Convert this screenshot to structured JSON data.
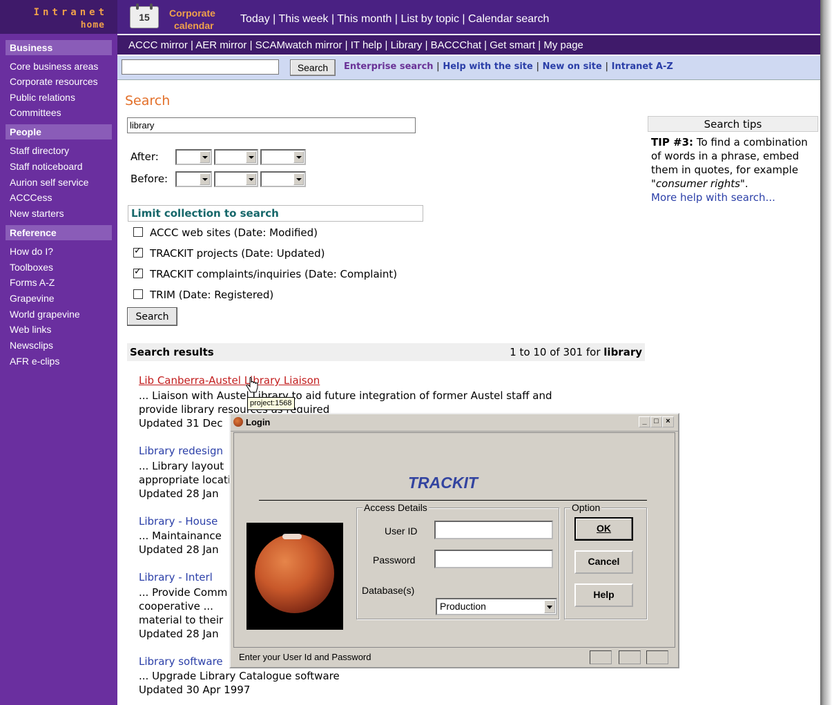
{
  "brand": {
    "line1": "Intranet",
    "line2": "home"
  },
  "sidebar": {
    "sections": [
      {
        "title": "Business",
        "items": [
          "Core business areas",
          "Corporate resources",
          "Public relations",
          "Committees"
        ]
      },
      {
        "title": "People",
        "items": [
          "Staff directory",
          "Staff noticeboard",
          "Aurion self service",
          "ACCCess",
          "New starters"
        ]
      },
      {
        "title": "Reference",
        "items": [
          "How do I?",
          "Toolboxes",
          "Forms A-Z",
          "Grapevine",
          "World grapevine",
          "Web links",
          "Newsclips",
          "AFR e-clips"
        ]
      }
    ]
  },
  "calendar": {
    "icon_text": "15",
    "title_line1": "Corporate",
    "title_line2": "calendar",
    "links": [
      "Today",
      "This week",
      "This month",
      "List by topic",
      "Calendar search"
    ]
  },
  "mirror_links": [
    "ACCC mirror",
    "AER mirror",
    "SCAMwatch mirror",
    "IT help",
    "Library",
    "BACCChat",
    "Get smart",
    "My page"
  ],
  "topsearch": {
    "value": "",
    "button": "Search",
    "links": [
      "Enterprise search",
      "Help with the site",
      "New on site",
      "Intranet A-Z"
    ]
  },
  "search": {
    "title": "Search",
    "query": "library",
    "after_label": "After:",
    "before_label": "Before:",
    "limit_title": "Limit collection to search",
    "collections": [
      {
        "label": "ACCC web sites (Date: Modified)",
        "checked": false
      },
      {
        "label": "TRACKIT projects (Date: Updated)",
        "checked": true
      },
      {
        "label": "TRACKIT complaints/inquiries (Date: Complaint)",
        "checked": true
      },
      {
        "label": "TRIM (Date: Registered)",
        "checked": false
      }
    ],
    "button": "Search"
  },
  "results": {
    "title": "Search results",
    "count_prefix": "1 to 10 of 301 for",
    "count_term": "library",
    "items": [
      {
        "title": "Lib Canberra-Austel Library Liaison",
        "lines": [
          "... Liaison with Austel Library to aid future integration of former Austel staff and",
          "provide library resources as required"
        ],
        "updated": "Updated 31 Dec"
      },
      {
        "title": "Library redesign",
        "lines": [
          "... Library layout",
          "appropriate location"
        ],
        "updated": "Updated 28 Jan"
      },
      {
        "title": "Library - House",
        "lines": [
          "... Maintainance"
        ],
        "updated": "Updated 28 Jan"
      },
      {
        "title": "Library - Interl",
        "lines": [
          "... Provide Comm",
          "cooperative ...",
          "material to their"
        ],
        "updated": "Updated 28 Jan"
      },
      {
        "title": "Library software",
        "lines": [
          "... Upgrade Library Catalogue software"
        ],
        "updated": "Updated 30 Apr 1997"
      }
    ]
  },
  "tooltip": "project:1568",
  "tips": {
    "title": "Search tips",
    "tip_label": "TIP #3:",
    "tip_text": "To find a combination of words in a phrase, embed them in quotes, for example",
    "tip_example": "\"consumer rights\"",
    "tip_end": ".",
    "more": "More help with search..."
  },
  "dialog": {
    "title": "Login",
    "app_name": "TRACKIT",
    "access_legend": "Access Details",
    "option_legend": "Option",
    "user_label": "User ID",
    "password_label": "Password",
    "database_label": "Database(s)",
    "database_value": "Production",
    "ok": "OK",
    "cancel": "Cancel",
    "help": "Help",
    "status": "Enter your User Id and Password",
    "window_buttons": [
      "_",
      "□",
      "×"
    ]
  },
  "colors": {
    "sidebar": "#6a2f9f",
    "topbar": "#4a2183",
    "accent_orange": "#f0a14a",
    "search_title": "#e3702a",
    "link_blue": "#2b3fa8",
    "active_link": "#c21d1d"
  }
}
